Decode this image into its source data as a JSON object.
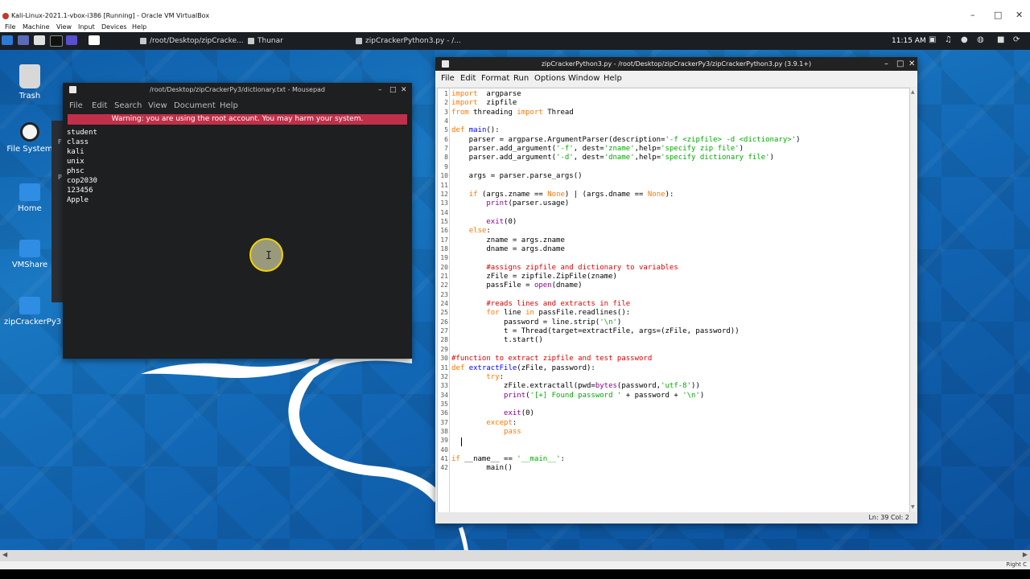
{
  "host": {
    "title": "Kali-Linux-2021.1-vbox-i386 [Running] - Oracle VM VirtualBox",
    "menu": [
      "File",
      "Machine",
      "View",
      "Input",
      "Devices",
      "Help"
    ],
    "host_key": "Right C"
  },
  "panel": {
    "tasks": [
      "/root/Desktop/zipCracke...",
      "Thunar",
      "zipCrackerPython3.py - /..."
    ],
    "clock": "11:15 AM"
  },
  "desktop_icons": [
    "Trash",
    "File System",
    "Home",
    "VMShare",
    "zipCrackerPy3"
  ],
  "mousepad": {
    "title": "/root/Desktop/zipCrackerPy3/dictionary.txt - Mousepad",
    "menu": [
      "File",
      "Edit",
      "Search",
      "View",
      "Document",
      "Help"
    ],
    "warning": "Warning: you are using the root account. You may harm your system.",
    "lines": [
      "student",
      "class",
      "kali",
      "unix",
      "phsc",
      "cop2030",
      "123456",
      "Apple"
    ]
  },
  "thunar_fragments": [
    "F",
    "P"
  ],
  "idle": {
    "title": "zipCrackerPython3.py - /root/Desktop/zipCrackerPy3/zipCrackerPython3.py (3.9.1+)",
    "menu": [
      "File",
      "Edit",
      "Format",
      "Run",
      "Options",
      "Window",
      "Help"
    ],
    "status": "Ln: 39   Col: 2",
    "code": [
      [
        [
          "kw",
          "import"
        ],
        [
          "",
          "  argparse"
        ]
      ],
      [
        [
          "kw",
          "import"
        ],
        [
          "",
          "  zipfile"
        ]
      ],
      [
        [
          "kw",
          "from"
        ],
        [
          "",
          " threading "
        ],
        [
          "kw",
          "import"
        ],
        [
          "",
          " Thread"
        ]
      ],
      [],
      [
        [
          "kw",
          "def"
        ],
        [
          "",
          " "
        ],
        [
          "fn",
          "main"
        ],
        [
          "",
          "():"
        ]
      ],
      [
        [
          "",
          "    parser = argparse.ArgumentParser(description="
        ],
        [
          "st",
          "'-f <zipfile> -d <dictionary>'"
        ],
        [
          "",
          ")"
        ]
      ],
      [
        [
          "",
          "    parser.add_argument("
        ],
        [
          "st",
          "'-f'"
        ],
        [
          "",
          ", dest="
        ],
        [
          "st",
          "'zname'"
        ],
        [
          "",
          ",help="
        ],
        [
          "st",
          "'specify zip file'"
        ],
        [
          "",
          ")"
        ]
      ],
      [
        [
          "",
          "    parser.add_argument("
        ],
        [
          "st",
          "'-d'"
        ],
        [
          "",
          ", dest="
        ],
        [
          "st",
          "'dname'"
        ],
        [
          "",
          ",help="
        ],
        [
          "st",
          "'specify dictionary file'"
        ],
        [
          "",
          ")"
        ]
      ],
      [],
      [
        [
          "",
          "    args = parser.parse_args()"
        ]
      ],
      [],
      [
        [
          "",
          "    "
        ],
        [
          "kw",
          "if"
        ],
        [
          "",
          " (args.zname == "
        ],
        [
          "kw",
          "None"
        ],
        [
          "",
          ") | (args.dname == "
        ],
        [
          "kw",
          "None"
        ],
        [
          "",
          "):"
        ]
      ],
      [
        [
          "",
          "        "
        ],
        [
          "bi",
          "print"
        ],
        [
          "",
          "(parser.usage)"
        ]
      ],
      [],
      [
        [
          "",
          "        "
        ],
        [
          "bi",
          "exit"
        ],
        [
          "",
          "(0)"
        ]
      ],
      [
        [
          "",
          "    "
        ],
        [
          "kw",
          "else"
        ],
        [
          "",
          ":"
        ]
      ],
      [
        [
          "",
          "        zname = args.zname"
        ]
      ],
      [
        [
          "",
          "        dname = args.dname"
        ]
      ],
      [],
      [
        [
          "",
          "        "
        ],
        [
          "cm",
          "#assigns zipfile and dictionary to variables"
        ]
      ],
      [
        [
          "",
          "        zFile = zipfile.ZipFile(zname)"
        ]
      ],
      [
        [
          "",
          "        passFile = "
        ],
        [
          "bi",
          "open"
        ],
        [
          "",
          "(dname)"
        ]
      ],
      [],
      [
        [
          "",
          "        "
        ],
        [
          "cm",
          "#reads lines and extracts in file"
        ]
      ],
      [
        [
          "",
          "        "
        ],
        [
          "kw",
          "for"
        ],
        [
          "",
          " line "
        ],
        [
          "kw",
          "in"
        ],
        [
          "",
          " passFile.readlines():"
        ]
      ],
      [
        [
          "",
          "            password = line.strip("
        ],
        [
          "st",
          "'\\n'"
        ],
        [
          "",
          ")"
        ]
      ],
      [
        [
          "",
          "            t = Thread(target=extractFile, args=(zFile, password))"
        ]
      ],
      [
        [
          "",
          "            t.start()"
        ]
      ],
      [],
      [
        [
          "cm",
          "#function to extract zipfile and test password"
        ]
      ],
      [
        [
          "kw",
          "def"
        ],
        [
          "",
          " "
        ],
        [
          "fn",
          "extractFile"
        ],
        [
          "",
          "(zFile, password):"
        ]
      ],
      [
        [
          "",
          "        "
        ],
        [
          "kw",
          "try"
        ],
        [
          "",
          ":"
        ]
      ],
      [
        [
          "",
          "            zFile.extractall(pwd="
        ],
        [
          "bi",
          "bytes"
        ],
        [
          "",
          "(password,"
        ],
        [
          "st",
          "'utf-8'"
        ],
        [
          "",
          "))"
        ]
      ],
      [
        [
          "",
          "            "
        ],
        [
          "bi",
          "print"
        ],
        [
          "",
          "("
        ],
        [
          "st",
          "'[+] Found password '"
        ],
        [
          "",
          " + password + "
        ],
        [
          "st",
          "'\\n'"
        ],
        [
          "",
          ")"
        ]
      ],
      [],
      [
        [
          "",
          "            "
        ],
        [
          "bi",
          "exit"
        ],
        [
          "",
          "(0)"
        ]
      ],
      [
        [
          "",
          "        "
        ],
        [
          "kw",
          "except"
        ],
        [
          "",
          ":"
        ]
      ],
      [
        [
          "",
          "            "
        ],
        [
          "kw",
          "pass"
        ]
      ],
      [],
      [],
      [
        [
          "kw",
          "if"
        ],
        [
          "",
          " __name__ == "
        ],
        [
          "st",
          "'__main__'"
        ],
        [
          "",
          ":"
        ]
      ],
      [
        [
          "",
          "        main()"
        ]
      ]
    ]
  }
}
